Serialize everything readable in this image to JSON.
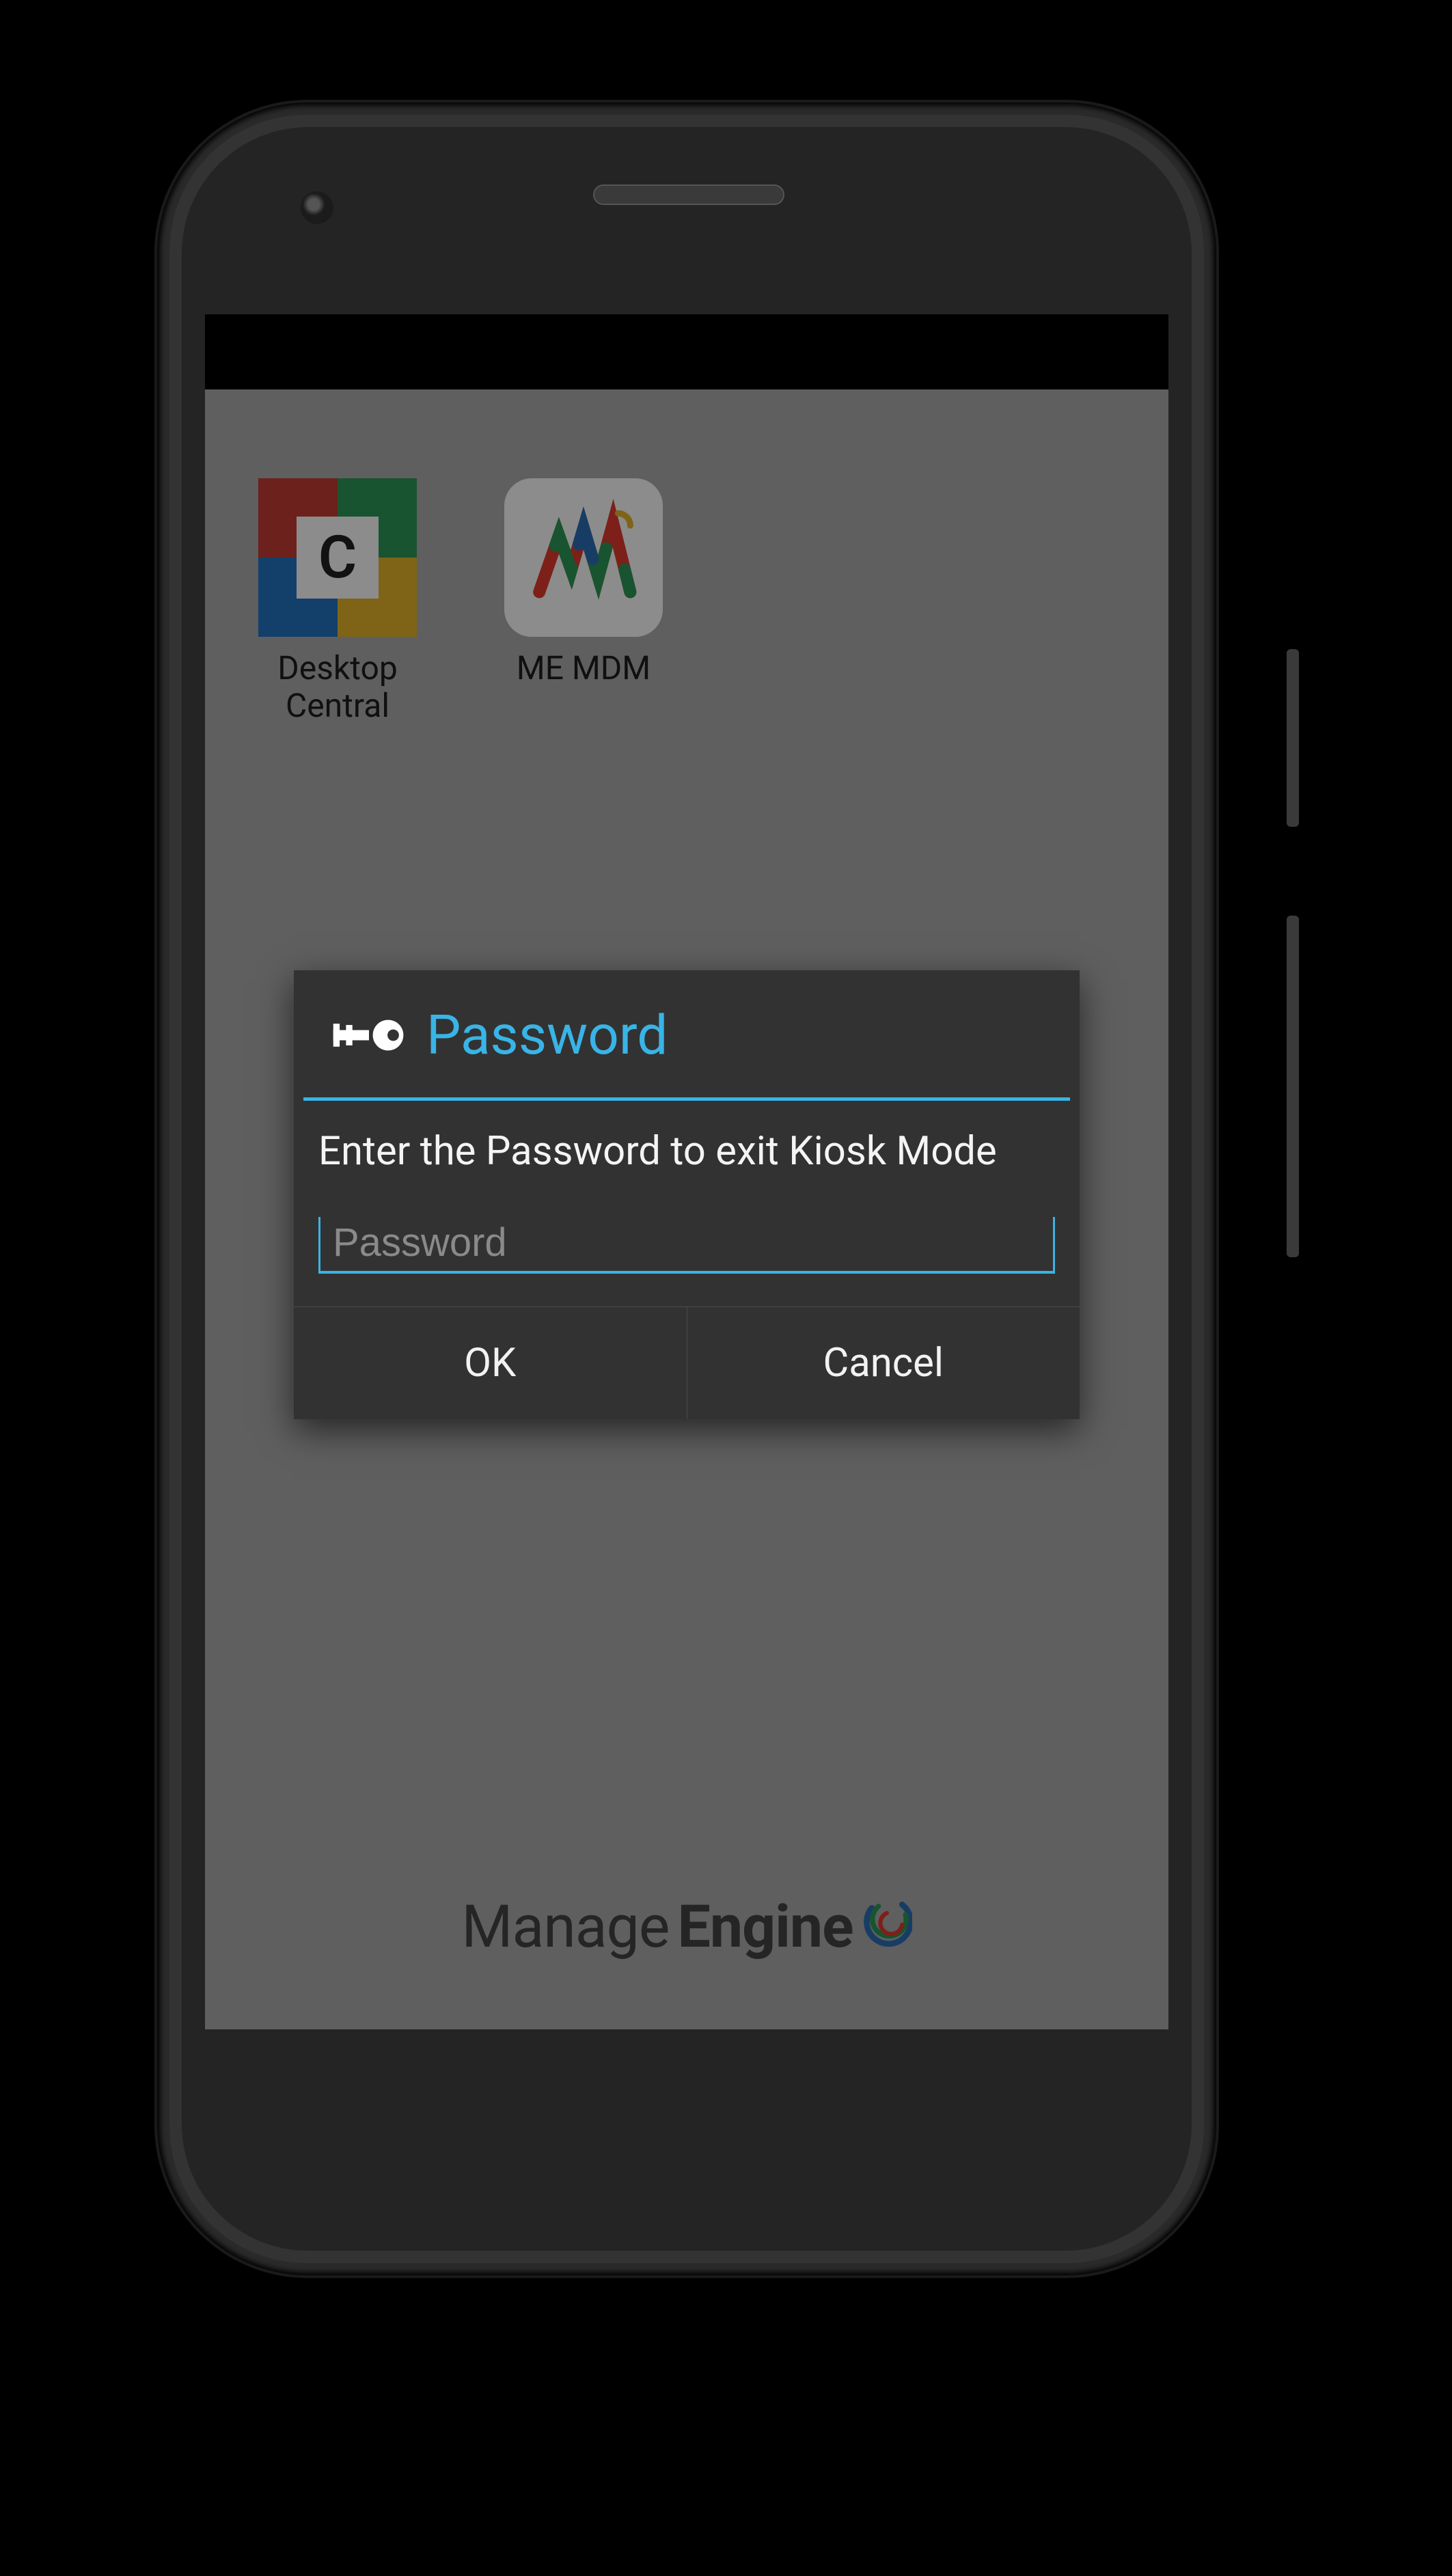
{
  "home": {
    "apps": [
      {
        "label": "Desktop Central"
      },
      {
        "label": "ME MDM"
      }
    ],
    "brand_a": "Manage",
    "brand_b": "Engine"
  },
  "dialog": {
    "title": "Password",
    "message": "Enter the Password to exit Kiosk Mode",
    "placeholder": "Password",
    "ok": "OK",
    "cancel": "Cancel"
  }
}
